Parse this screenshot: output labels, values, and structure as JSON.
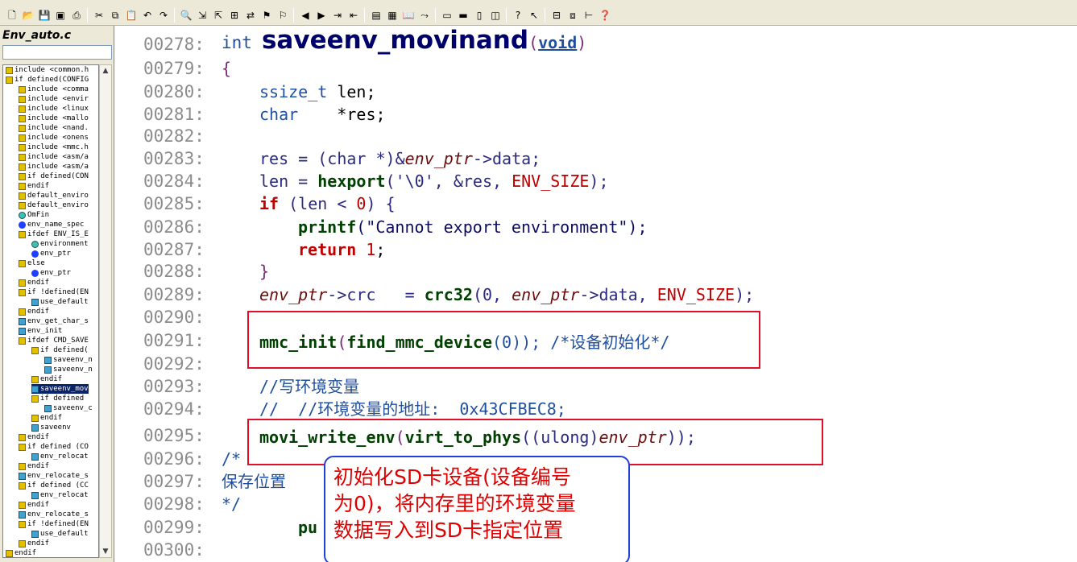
{
  "window": {
    "file_title": "Env_auto.c"
  },
  "toolbar_icons": [
    "new-file",
    "open",
    "save",
    "save-all",
    "print",
    "cut",
    "copy",
    "paste",
    "undo",
    "redo",
    "find",
    "find-next",
    "find-prev",
    "find-in-files",
    "replace",
    "bookmark-set",
    "bookmark-clear",
    "back",
    "forward",
    "indent",
    "outdent",
    "project",
    "symbol-window",
    "book",
    "relation",
    "layout-1",
    "layout-2",
    "layout-3",
    "layout-4",
    "context-help",
    "whats-this",
    "tile",
    "cascade",
    "split",
    "help"
  ],
  "symbols": [
    {
      "icon": "hash",
      "indent": 0,
      "label": "include <common.h"
    },
    {
      "icon": "hash",
      "indent": 0,
      "label": "if defined(CONFIG"
    },
    {
      "icon": "hash",
      "indent": 1,
      "label": "include <comma"
    },
    {
      "icon": "hash",
      "indent": 1,
      "label": "include <envir"
    },
    {
      "icon": "hash",
      "indent": 1,
      "label": "include <linux"
    },
    {
      "icon": "hash",
      "indent": 1,
      "label": "include <mallo"
    },
    {
      "icon": "hash",
      "indent": 1,
      "label": "include <nand."
    },
    {
      "icon": "hash",
      "indent": 1,
      "label": "include <onens"
    },
    {
      "icon": "hash",
      "indent": 1,
      "label": "include <mmc.h"
    },
    {
      "icon": "hash",
      "indent": 1,
      "label": "include <asm/a"
    },
    {
      "icon": "hash",
      "indent": 1,
      "label": "include <asm/a"
    },
    {
      "icon": "hash",
      "indent": 1,
      "label": "if defined(CON"
    },
    {
      "icon": "hash",
      "indent": 1,
      "label": "endif"
    },
    {
      "icon": "hash",
      "indent": 1,
      "label": "default_enviro"
    },
    {
      "icon": "hash",
      "indent": 1,
      "label": "default_enviro"
    },
    {
      "icon": "var",
      "indent": 1,
      "label": "OmFin"
    },
    {
      "icon": "dot",
      "indent": 1,
      "label": "env_name_spec"
    },
    {
      "icon": "hash",
      "indent": 1,
      "label": "ifdef ENV_IS_E"
    },
    {
      "icon": "var",
      "indent": 2,
      "label": "environment"
    },
    {
      "icon": "dot",
      "indent": 2,
      "label": "env_ptr"
    },
    {
      "icon": "hash",
      "indent": 1,
      "label": "else"
    },
    {
      "icon": "dot",
      "indent": 2,
      "label": "env_ptr"
    },
    {
      "icon": "hash",
      "indent": 1,
      "label": "endif"
    },
    {
      "icon": "hash",
      "indent": 1,
      "label": "if !defined(EN"
    },
    {
      "icon": "fn",
      "indent": 2,
      "label": "use_default"
    },
    {
      "icon": "hash",
      "indent": 1,
      "label": "endif"
    },
    {
      "icon": "fn",
      "indent": 1,
      "label": "env_get_char_s"
    },
    {
      "icon": "fn",
      "indent": 1,
      "label": "env_init"
    },
    {
      "icon": "hash",
      "indent": 1,
      "label": "ifdef CMD_SAVE"
    },
    {
      "icon": "hash",
      "indent": 2,
      "label": "if defined("
    },
    {
      "icon": "fn",
      "indent": 3,
      "label": "saveenv_n"
    },
    {
      "icon": "fn",
      "indent": 3,
      "label": "saveenv_n"
    },
    {
      "icon": "hash",
      "indent": 2,
      "label": "endif"
    },
    {
      "icon": "fn",
      "indent": 2,
      "label": "saveenv_mov",
      "selected": true
    },
    {
      "icon": "hash",
      "indent": 2,
      "label": "if defined"
    },
    {
      "icon": "fn",
      "indent": 3,
      "label": "saveenv_c"
    },
    {
      "icon": "hash",
      "indent": 2,
      "label": "endif"
    },
    {
      "icon": "fn",
      "indent": 2,
      "label": "saveenv"
    },
    {
      "icon": "hash",
      "indent": 1,
      "label": "endif"
    },
    {
      "icon": "hash",
      "indent": 1,
      "label": "if defined (CO"
    },
    {
      "icon": "fn",
      "indent": 2,
      "label": "env_relocat"
    },
    {
      "icon": "hash",
      "indent": 1,
      "label": "endif"
    },
    {
      "icon": "fn",
      "indent": 1,
      "label": "env_relocate_s"
    },
    {
      "icon": "hash",
      "indent": 1,
      "label": "if defined (CC"
    },
    {
      "icon": "fn",
      "indent": 2,
      "label": "env_relocat"
    },
    {
      "icon": "hash",
      "indent": 1,
      "label": "endif"
    },
    {
      "icon": "fn",
      "indent": 1,
      "label": "env_relocate_s"
    },
    {
      "icon": "hash",
      "indent": 1,
      "label": "if !defined(EN"
    },
    {
      "icon": "fn",
      "indent": 2,
      "label": "use_default"
    },
    {
      "icon": "hash",
      "indent": 1,
      "label": "endif"
    },
    {
      "icon": "hash",
      "indent": 0,
      "label": "endif"
    }
  ],
  "code": {
    "l278": {
      "num": "00278:",
      "t1": "int",
      "t2": "saveenv_movinand",
      "t3": "(",
      "t4": "void",
      "t5": ")"
    },
    "l279": {
      "num": "00279:",
      "t1": "{"
    },
    "l280": {
      "num": "00280:",
      "t1": "ssize_t",
      "t2": " len",
      "t3": ";"
    },
    "l281": {
      "num": "00281:",
      "t1": "char",
      "t2": "    *res",
      "t3": ";"
    },
    "l282": {
      "num": "00282:"
    },
    "l283": {
      "num": "00283:",
      "t1": "res = (char *)&",
      "t2": "env_ptr",
      "t3": "->data;"
    },
    "l284": {
      "num": "00284:",
      "t1": "len = ",
      "t2": "hexport",
      "t3": "('\\0', &res, ",
      "t4": "ENV_SIZE",
      "t5": ");"
    },
    "l285": {
      "num": "00285:",
      "t1": "if",
      "t2": " (len < ",
      "t3": "0",
      "t4": ") {"
    },
    "l286": {
      "num": "00286:",
      "t1": "printf",
      "t2": "(\"Cannot export environment\");"
    },
    "l287": {
      "num": "00287:",
      "t1": "return",
      "t2": " 1",
      "t3": ";"
    },
    "l288": {
      "num": "00288:",
      "t1": "}"
    },
    "l289": {
      "num": "00289:",
      "t1": "env_ptr",
      "t2": "->crc   = ",
      "t3": "crc32",
      "t4": "(0, ",
      "t5": "env_ptr",
      "t6": "->data, ",
      "t7": "ENV_SIZE",
      "t8": ");"
    },
    "l290": {
      "num": "00290:"
    },
    "l291": {
      "num": "00291:",
      "t1": "mmc_init",
      "t2": "(",
      "t3": "find_mmc_device",
      "t4": "(0)); /*设备初始化*/"
    },
    "l292": {
      "num": "00292:"
    },
    "l293": {
      "num": "00293:",
      "t1": "//写环境变量"
    },
    "l294": {
      "num": "00294:",
      "t1": "//  //环境变量的地址:  0x43CFBEC8;"
    },
    "l295": {
      "num": "00295:",
      "t1": "movi_write_env",
      "t2": "(",
      "t3": "virt_to_phys",
      "t4": "((ulong)",
      "t5": "env_ptr",
      "t6": "));"
    },
    "l296": {
      "num": "00296:",
      "t1": "/*"
    },
    "l297": {
      "num": "00297:",
      "t1": "保存位置"
    },
    "l298": {
      "num": "00298:",
      "t1": "*/"
    },
    "l299": {
      "num": "00299:",
      "t1": "pu"
    },
    "l300": {
      "num": "00300:"
    }
  },
  "callout": {
    "line1": "初始化SD卡设备(设备编号",
    "line2": "为0)，将内存里的环境变量",
    "line3": "数据写入到SD卡指定位置"
  },
  "colors": {
    "highlight_box": "#e0102a",
    "callout_border": "#2040d8",
    "callout_text": "#e00000"
  }
}
